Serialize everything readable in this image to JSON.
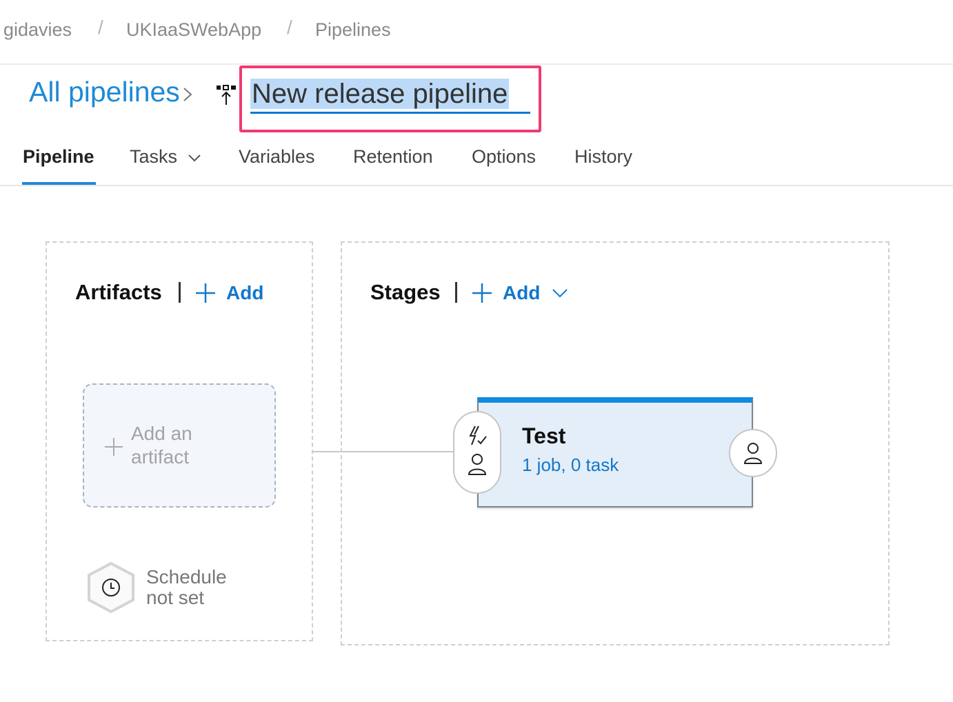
{
  "breadcrumb": {
    "items": [
      "gidavies",
      "UKIaaSWebApp",
      "Pipelines"
    ],
    "separator": "/"
  },
  "header": {
    "all_pipelines_label": "All pipelines",
    "pipeline_name": "New release pipeline",
    "chevron_icon": "chevron-right-icon",
    "pipeline_icon": "release-pipeline-icon"
  },
  "tabs": [
    {
      "label": "Pipeline",
      "active": true
    },
    {
      "label": "Tasks",
      "active": false,
      "dropdown": true
    },
    {
      "label": "Variables",
      "active": false
    },
    {
      "label": "Retention",
      "active": false
    },
    {
      "label": "Options",
      "active": false
    },
    {
      "label": "History",
      "active": false
    }
  ],
  "artifacts": {
    "title": "Artifacts",
    "add_label": "Add",
    "placeholder_line1": "Add an",
    "placeholder_line2": "artifact",
    "schedule_line1": "Schedule",
    "schedule_line2": "not set"
  },
  "stages": {
    "title": "Stages",
    "add_label": "Add",
    "items": [
      {
        "name": "Test",
        "summary": "1 job, 0 task"
      }
    ]
  },
  "colors": {
    "accent": "#1e8ad6",
    "highlight_border": "#f03b72",
    "stage_bar": "#128ae0",
    "stage_bg": "#e3eef9"
  }
}
